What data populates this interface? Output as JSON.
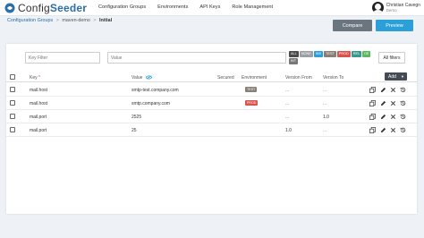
{
  "app": {
    "logo_prefix": "Config",
    "logo_suffix": "Seeder"
  },
  "nav": {
    "items": [
      {
        "label": "Configuration Groups"
      },
      {
        "label": "Environments"
      },
      {
        "label": "API Keys"
      },
      {
        "label": "Role Management"
      }
    ]
  },
  "user": {
    "name": "Christian Cavegn",
    "role": "Demo"
  },
  "breadcrumb": {
    "root": "Configuration Groups",
    "group": "maven-demo",
    "current": "Initial",
    "separator": ">"
  },
  "toolbar": {
    "compare_label": "Compare",
    "preview_label": "Preview",
    "all_filters_label": "All filters",
    "add_label": "Add",
    "add_caret": "▼"
  },
  "filters": {
    "key_placeholder": "Key Filter",
    "value_placeholder": "Value"
  },
  "env_tags": [
    {
      "label": "ALL",
      "color": "#4a4a4a"
    },
    {
      "label": "NONE",
      "color": "#9aa0a6"
    },
    {
      "label": "INS",
      "color": "#2ba0d8"
    },
    {
      "label": "TEST",
      "color": "#8a7f76"
    },
    {
      "label": "PROD",
      "color": "#d9534f"
    },
    {
      "label": "REL",
      "color": "#3a9a8a"
    },
    {
      "label": "DE",
      "color": "#5cb85c"
    },
    {
      "label": "INT",
      "color": "#777777"
    }
  ],
  "table": {
    "headers": {
      "key": "Key",
      "key_required": "*",
      "value": "Value",
      "secured": "Secured",
      "environment": "Environment",
      "version_from": "Version From",
      "version_to": "Version To"
    },
    "rows": [
      {
        "key": "mail.host",
        "value": "smtp-test.company.com",
        "env": "TEST",
        "env_color": "#8a7f76",
        "version_from": "...",
        "version_to": "..."
      },
      {
        "key": "mail.host",
        "value": "smtp.company.com",
        "env": "PROD",
        "env_color": "#d9534f",
        "version_from": "...",
        "version_to": "..."
      },
      {
        "key": "mail.port",
        "value": "2525",
        "env": "",
        "env_color": "",
        "version_from": "...",
        "version_to": "1.0"
      },
      {
        "key": "mail.port",
        "value": "25",
        "env": "",
        "env_color": "",
        "version_from": "1.0",
        "version_to": "..."
      }
    ]
  },
  "colors": {
    "accent": "#2ba0d8",
    "compare": "#6b7580",
    "add": "#444b55"
  }
}
